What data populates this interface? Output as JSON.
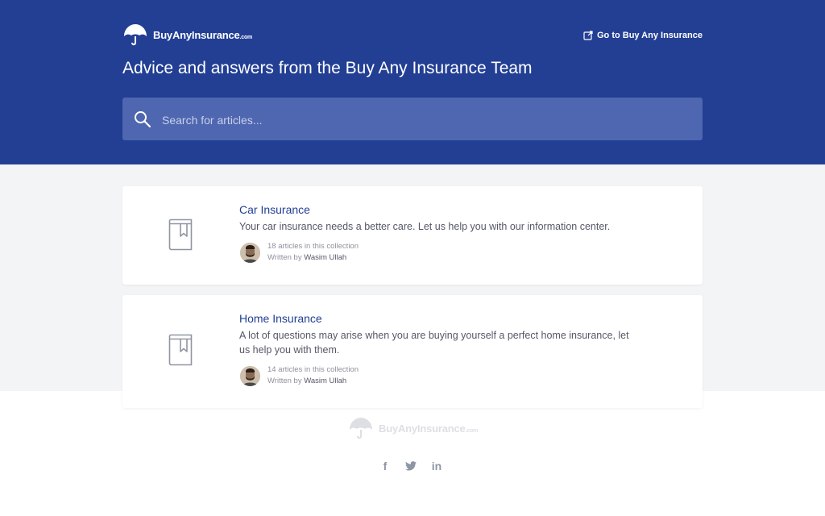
{
  "header": {
    "logo_text": "BuyAnyInsurance",
    "logo_suffix": ".com",
    "goto_link": "Go to Buy Any Insurance",
    "headline": "Advice and answers from the Buy Any Insurance Team",
    "search_placeholder": "Search for articles..."
  },
  "collections": [
    {
      "title": "Car Insurance",
      "description": "Your car insurance needs a better care. Let us help you with our information center.",
      "article_count": "18 articles in this collection",
      "written_by_label": "Written by",
      "author": "Wasim Ullah",
      "icon": "book-bookmark-icon"
    },
    {
      "title": "Home Insurance",
      "description": "A lot of questions may arise when you are buying yourself a perfect home insurance, let us help you with them.",
      "article_count": "14 articles in this collection",
      "written_by_label": "Written by",
      "author": "Wasim Ullah",
      "icon": "book-bookmark-icon"
    }
  ],
  "footer": {
    "logo_text": "BuyAnyInsurance",
    "logo_suffix": ".com",
    "social": [
      "f",
      "t",
      "in"
    ]
  },
  "colors": {
    "header_bg": "#223f94",
    "search_bg": "#4f67b0",
    "link": "#223f94",
    "band_bg": "#f3f4f6"
  }
}
